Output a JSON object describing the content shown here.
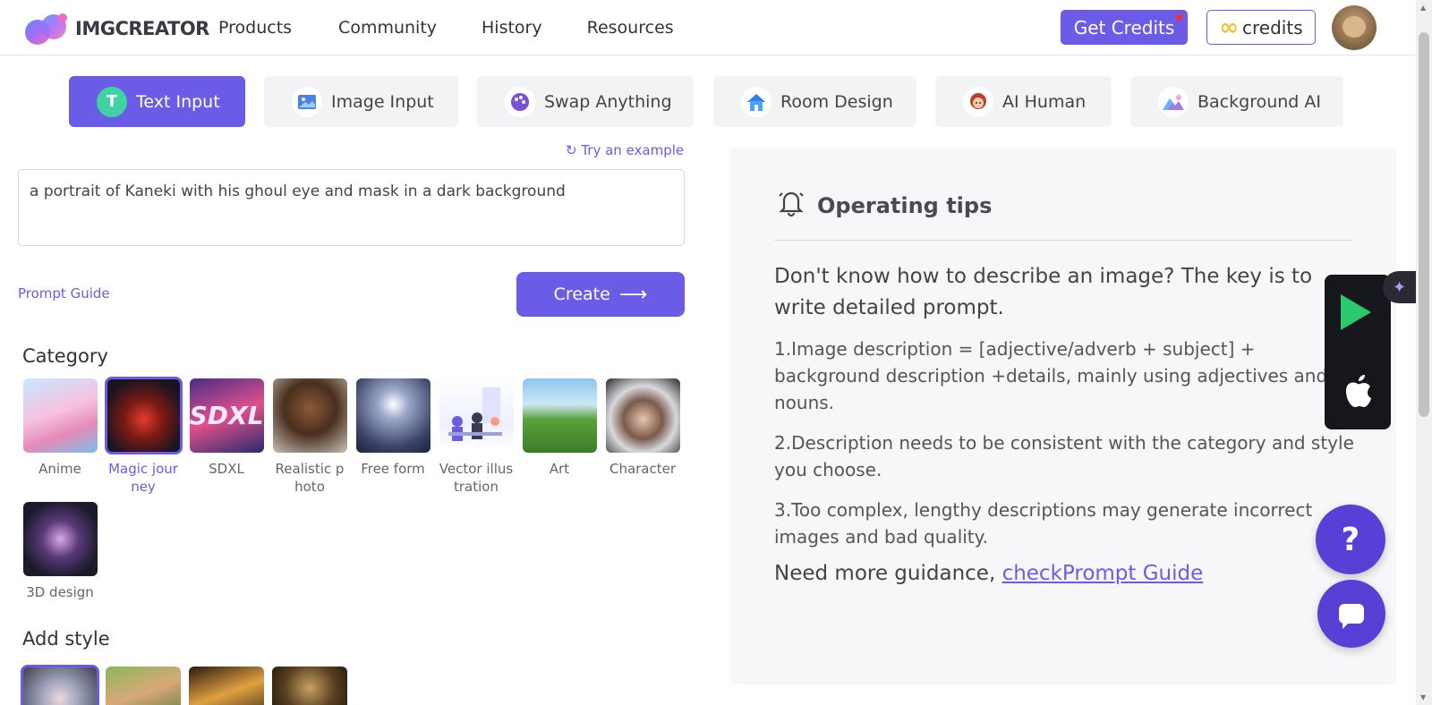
{
  "brand": {
    "name": "IMGCREATOR"
  },
  "nav": {
    "items": [
      "Products",
      "Community",
      "History",
      "Resources"
    ],
    "get_credits": "Get Credits",
    "credits": "credits"
  },
  "tabs": [
    {
      "label": "Text Input",
      "icon": "text-icon",
      "active": true
    },
    {
      "label": "Image Input",
      "icon": "image-icon",
      "active": false
    },
    {
      "label": "Swap Anything",
      "icon": "palette-icon",
      "active": false
    },
    {
      "label": "Room Design",
      "icon": "house-icon",
      "active": false
    },
    {
      "label": "AI Human",
      "icon": "person-icon",
      "active": false
    },
    {
      "label": "Background AI",
      "icon": "mountain-icon",
      "active": false
    }
  ],
  "input": {
    "try_example": "Try an example",
    "prompt": "a portrait of Kaneki with his ghoul eye and mask in a dark background",
    "prompt_guide": "Prompt Guide",
    "create": "Create"
  },
  "category": {
    "title": "Category",
    "items": [
      {
        "label": "Anime",
        "selected": false
      },
      {
        "label": "Magic journey",
        "selected": true
      },
      {
        "label": "SDXL",
        "selected": false
      },
      {
        "label": "Realistic photo",
        "selected": false
      },
      {
        "label": "Free form",
        "selected": false
      },
      {
        "label": "Vector illustration",
        "selected": false
      },
      {
        "label": "Art",
        "selected": false
      },
      {
        "label": "Character",
        "selected": false
      },
      {
        "label": "3D design",
        "selected": false
      }
    ],
    "sdxl_text": "SDXL"
  },
  "style": {
    "title": "Add style"
  },
  "tips": {
    "title": "Operating tips",
    "intro": "Don't know how to describe an image? The key is to write detailed prompt.",
    "items": [
      "1.Image description = [adjective/adverb + subject] + background description +details, mainly using adjectives and nouns.",
      "2.Description needs to be consistent with the category and style you choose.",
      "3.Too complex, lengthy descriptions may generate incorrect images and bad quality."
    ],
    "guidance_prefix": "Need more guidance, ",
    "guidance_link": "checkPrompt Guide"
  },
  "float": {
    "help": "?"
  },
  "colors": {
    "accent": "#6b5ce7",
    "panel": "#f7f7f9"
  }
}
